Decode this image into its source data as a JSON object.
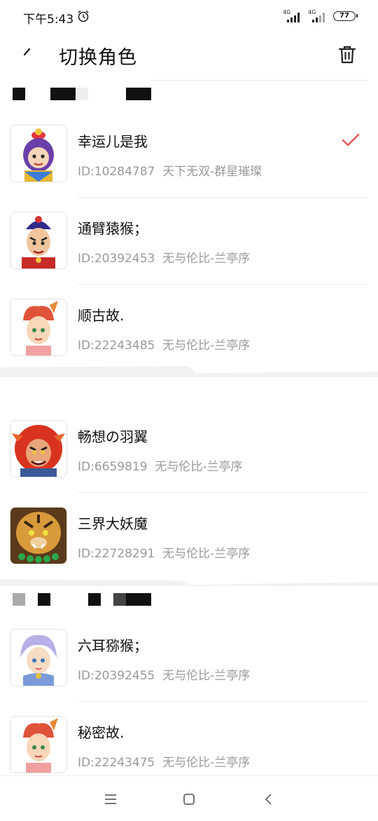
{
  "status": {
    "time": "下午5:43",
    "signal1": "4G",
    "signal2": "4G",
    "battery": "77"
  },
  "header": {
    "title": "切换角色"
  },
  "roles": [
    {
      "name": "幸运儿是我",
      "id": "ID:10284787",
      "server": "天下无双-群星璀璨",
      "selected": true,
      "avatar": "purple-hero-icon"
    },
    {
      "name": "通臂猿猴；",
      "id": "ID:20392453",
      "server": "无与伦比-兰亭序",
      "selected": false,
      "avatar": "warrior-boy-icon"
    },
    {
      "name": "顺古故.",
      "id": "ID:22243485",
      "server": "无与伦比-兰亭序",
      "selected": false,
      "avatar": "fox-girl-icon"
    },
    {
      "name": "畅想の羽翼",
      "id": "ID:6659819",
      "server": "无与伦比-兰亭序",
      "selected": false,
      "avatar": "red-lion-icon"
    },
    {
      "name": "三界大妖魔",
      "id": "ID:22728291",
      "server": "无与伦比-兰亭序",
      "selected": false,
      "avatar": "tiger-demon-icon"
    },
    {
      "name": "六耳猕猴；",
      "id": "ID:20392455",
      "server": "无与伦比-兰亭序",
      "selected": false,
      "avatar": "fairy-girl-icon"
    },
    {
      "name": "秘密故.",
      "id": "ID:22243475",
      "server": "无与伦比-兰亭序",
      "selected": false,
      "avatar": "fox-girl-icon"
    }
  ],
  "colors": {
    "accent": "#e05a5a",
    "muted": "#9a9a9a"
  }
}
